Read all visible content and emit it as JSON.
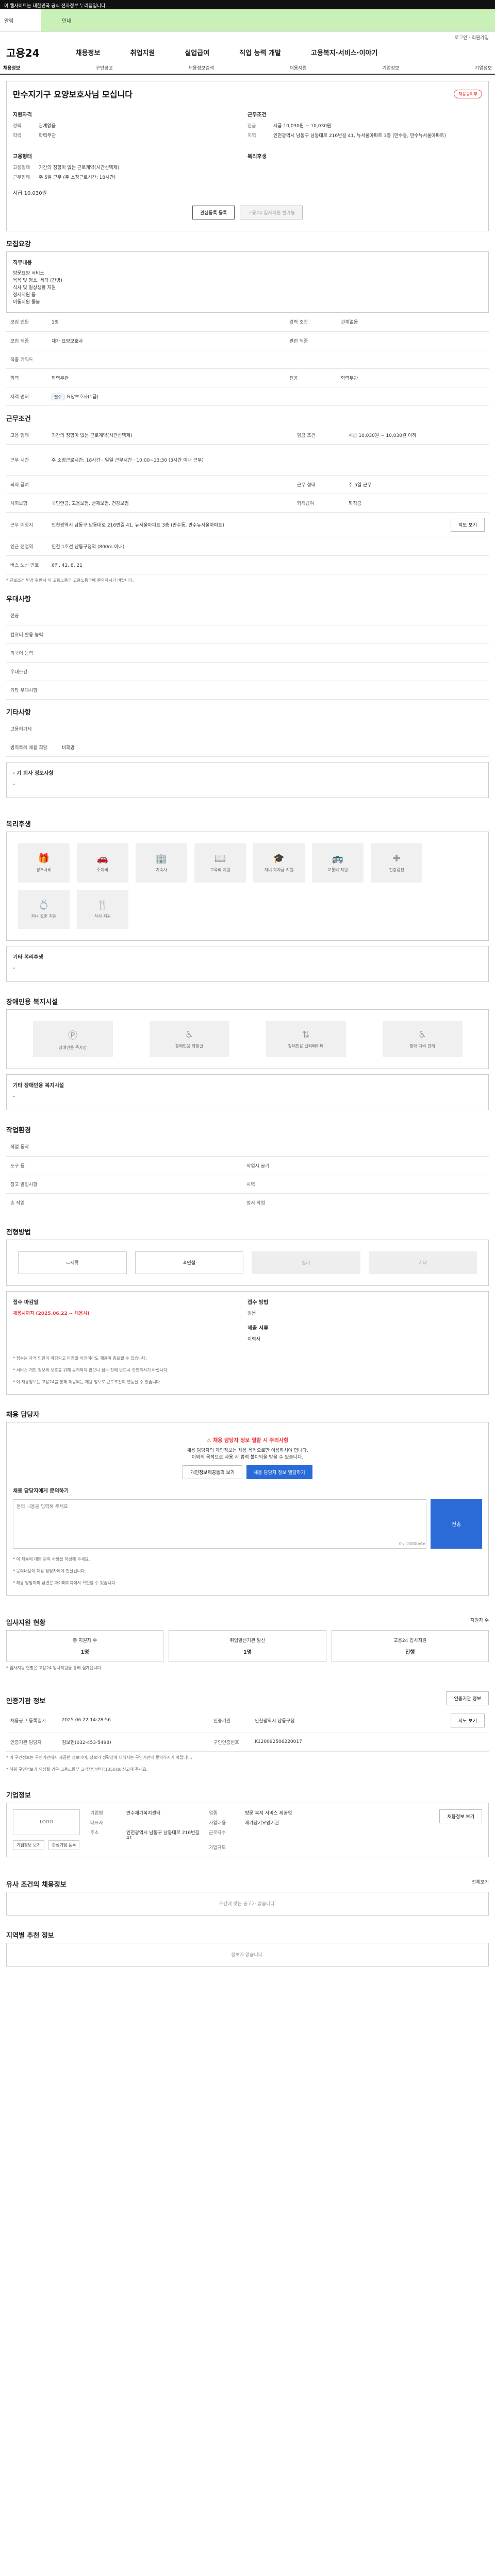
{
  "topbar": {
    "text": "이 웹사이트는 대한민국 공식 전자정부 누리집입니다."
  },
  "alert": {
    "left": "알림",
    "green": "안내"
  },
  "util": {
    "right": "로그인 · 회원가입"
  },
  "header": {
    "logo": "고용24",
    "menu": [
      "채용정보",
      "취업지원",
      "실업급여",
      "직업 능력 개발",
      "고용복지·서비스·이야기"
    ]
  },
  "subnav": [
    "채용정보",
    "구인공고",
    "채용정보검색",
    "채용지원",
    "기업정보",
    "기업정보"
  ],
  "job": {
    "title": "만수지기구 요양보호사님 모십니다",
    "badge": "채용중여부",
    "left_h": "지원자격",
    "left": [
      {
        "k": "경력",
        "v": "관계없음"
      },
      {
        "k": "학력",
        "v": "학력무관"
      }
    ],
    "right_h": "근무조건",
    "right": [
      {
        "k": "임금",
        "v": "시급 10,030원 ~ 10,030원"
      },
      {
        "k": "지역",
        "v": "인천광역시 남동구 남동대로 216번길 41, 뉴서울아파트 3층 (만수동, 만수뉴서울아파트)"
      }
    ],
    "left2_h": "고용형태",
    "left2": [
      {
        "k": "고용형태",
        "v": "기간의 정함이 없는 근로계약(시간선택제)"
      },
      {
        "k": "근무형태",
        "v": "주 5일 근무 (주 소정근로시간: 18시간)"
      }
    ],
    "right2_h": "복리후생",
    "wage_big": "시급 10,030원",
    "btn_apply": "관심등록 등록",
    "btn_info": "고용24 입사지원 불가능"
  },
  "recruit": {
    "h": "모집요강",
    "desc_h": "직무내용",
    "desc": [
      "방문요양 서비스",
      "목욕 및 청소, 세탁 (간병)",
      "식사 및 일상생활 지원",
      "정서지원 등",
      "이동지원 돌봄"
    ],
    "rows": [
      {
        "k": "모집 인원",
        "v": "1명",
        "k2": "경력 조건",
        "v2": "관계없음"
      },
      {
        "k": "모집 직종",
        "v": "재가 요양보호사",
        "k2": "관련 직종",
        "v2": ""
      },
      {
        "k": "직종 키워드",
        "v": "",
        "k2": "",
        "v2": ""
      },
      {
        "k": "학력",
        "v": "학력무관",
        "k2": "전공",
        "v2": "학력무관"
      },
      {
        "k": "자격 면허",
        "v": "요양보호사(1급)",
        "tag": "필수",
        "k2": "",
        "v2": ""
      }
    ]
  },
  "cond": {
    "h": "근무조건",
    "rows": [
      {
        "k": "고용 형태",
        "v": "기간의 정함이 없는 근로계약(시간선택제)",
        "k2": "임금 조건",
        "v2": "시급 10,030원 ~ 10,030원 이하"
      },
      {
        "k": "근무 시간",
        "v": "주 소정근로시간: 18시간 · 일일 근무시간 · 10:00~13:30 (3시간 이내 근무)",
        "k2": "",
        "v2": ""
      },
      {
        "k": "퇴직 급여",
        "v": "",
        "k2": "근무 형태",
        "v2": "주 5일 근무"
      },
      {
        "k": "사회보험",
        "v": "국민연금, 고용보험, 산재보험, 건강보험",
        "k2": "퇴직급여",
        "v2": "퇴직금"
      },
      {
        "k": "근무 예정지",
        "v": "인천광역시 남동구 남동대로 216번길 41, 뉴서울아파트 3층 (만수동, 만수뉴서울아파트)",
        "k2": "",
        "v2": "지도 보기"
      },
      {
        "k": "인근 전철역",
        "v": "인천 1호선 남동구청역 (800m 이내)",
        "k2": "",
        "v2": ""
      },
      {
        "k": "버스 노선 번호",
        "v": "6번, 42, 8, 21",
        "k2": "",
        "v2": ""
      }
    ],
    "note": "* 근로조건 변경 위반시 이 고용노동부 고용노동부에 문의하시기 바랍니다."
  },
  "prefer": {
    "h": "우대사항",
    "rows": [
      "전공",
      "컴퓨터 활용 능력",
      "외국어 능력",
      "우대조건",
      "기타 우대사항"
    ]
  },
  "other": {
    "h": "기타사항",
    "rows": [
      {
        "k": "고용허가제",
        "v": ""
      },
      {
        "k": "병역특례 채용 희망",
        "v": "비희망"
      }
    ],
    "note": "· 기 회사 정보사항",
    "dash": "-"
  },
  "welfare": {
    "h": "복리후생",
    "items": [
      "경조사비",
      "주차비",
      "기숙사",
      "교육비 지원",
      "자녀 학자금 지원",
      "교통비 지원",
      "건강검진",
      "자녀 결혼 지원",
      "식사 지원"
    ],
    "other_h": "기타 복리후생",
    "dash": "-"
  },
  "disab": {
    "h": "장애인용 복지시설",
    "items": [
      "장애인용 주차장",
      "장애인용 화장실",
      "장애인용 엘리베이터",
      "장애 대비 관계"
    ],
    "other_h": "기타 장애인용 복지시설",
    "dash": "-"
  },
  "env": {
    "h": "작업환경",
    "rows": [
      {
        "k": "작업 동작",
        "v": "",
        "k2": "",
        "v2": ""
      },
      {
        "k": "도구 등",
        "v": "",
        "k2": "작업시 공기",
        "v2": ""
      },
      {
        "k": "참고 알림사항",
        "v": "",
        "k2": "시력",
        "v2": ""
      },
      {
        "k": "손 작업",
        "v": "",
        "k2": "정서 작업",
        "v2": ""
      }
    ]
  },
  "process": {
    "h": "전형방법",
    "tabs": [
      "서류",
      "면접",
      "필기",
      "기타"
    ],
    "rows": [
      {
        "k": "접수 마감일",
        "v": "채용시까지 (2025.06.22 ~ 채용시)",
        "k2": "접수 방법",
        "v2": "방문"
      },
      {
        "k": "",
        "v": "",
        "k2": "제출 서류",
        "v2": "이력서"
      }
    ],
    "notes": [
      "* 접수는 자격 인원이 마감되고 마감일 이전이라도 채용이 종료될 수 있습니다.",
      "* 서비스 개인 정보의 보호를 위해 공개되지 않으니 접수 전에 반드시 확인하시기 바랍니다.",
      "* 이 채용정보는 고용24를 통해 제공되는 채용 정보로 근로조건이 변동될 수 있습니다."
    ]
  },
  "manager": {
    "h": "채용 담당자",
    "alert_t": "채용 담당자 정보 열람 시 주의사항",
    "alert_1": "채용 담당자의 개인정보는 채용 목적으로만 이용하셔야 합니다.",
    "alert_2": "이외의 목적으로 사용 시 법적 불이익을 받을 수 있습니다.",
    "btn_1": "개인정보제공동의 보기",
    "btn_2": "채용 담당자 정보 열람하기",
    "inq_h": "채용 담당자에게 문의하기",
    "inq_ph": "문의 내용을 입력해 주세요",
    "send": "전송",
    "counter": "0 / 1000byte",
    "notes": [
      "* 이 채용에 대한 문의 사항을 작성해 주세요.",
      "* 문의내용이 채용 담당자에게 전달됩니다.",
      "* 채용 담당자의 답변은 마이페이지에서 확인할 수 있습니다."
    ]
  },
  "status": {
    "h": "입사지원 현황",
    "link": "지원자 수",
    "items": [
      {
        "label": "총 지원자 수",
        "n": "1명"
      },
      {
        "label": "취업알선기관 알선",
        "n": "1명"
      },
      {
        "label": "고용24 입사지원",
        "n": "진행"
      }
    ],
    "note": "* 입사지원 현황은 고용24 입사지원을 통해 집계됩니다."
  },
  "cert": {
    "h": "인증기관 정보",
    "btn": "인증기관 정보",
    "rows": [
      {
        "k": "채용공고 등록일시",
        "v": "2025.06.22 14:28:56",
        "k2": "인증기관",
        "v2": "인천광역시 남동구청",
        "k3": "",
        "v3": "지도 보기"
      },
      {
        "k": "인증기관 담당자",
        "v": "김보현(032-453-5498)",
        "k2": "구인인증번호",
        "v2": "K120092506220017",
        "k3": "",
        "v3": ""
      }
    ],
    "notes": [
      "* 이 구인정보는 구인기관에서 제공한 정보이며, 정보의 정확성에 대해서는 구인기관에 문의하시기 바랍니다.",
      "* 허위 구인정보가 의심될 경우 고용노동부 고객상담센터(1350)로 신고해 주세요."
    ]
  },
  "company": {
    "h": "기업정보",
    "logo": "LOGO",
    "rows": [
      {
        "k": "기업명",
        "v": "만수재가복지센터",
        "k2": "업종",
        "v2": "방문 복지 서비스 제공업"
      },
      {
        "k": "대표자",
        "v": "",
        "k2": "사업내용",
        "v2": "재가장기요양기관"
      },
      {
        "k": "주소",
        "v": "인천광역시 남동구 남동대로 216번길 41",
        "k2": "근로자수",
        "v2": ""
      },
      {
        "k": "",
        "v": "",
        "k2": "기업규모",
        "v2": ""
      }
    ],
    "btns": [
      "기업정보 보기",
      "관심기업 등록"
    ],
    "right_btn": "채용정보 보기"
  },
  "similar": {
    "h": "유사 조건의 채용정보",
    "empty": "조건에 맞는 공고가 없습니다.",
    "link": "전체보기"
  },
  "region": {
    "h": "지역별 추천 정보",
    "empty": "정보가 없습니다."
  }
}
